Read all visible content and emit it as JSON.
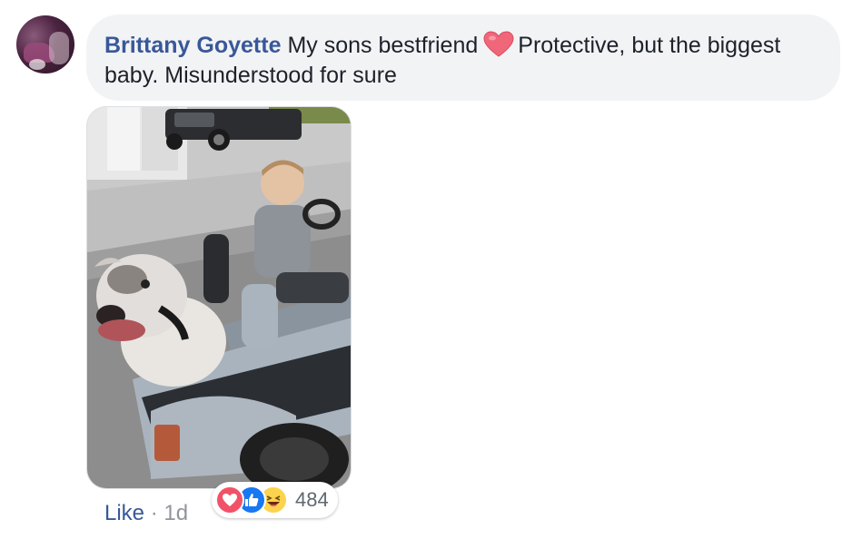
{
  "comment": {
    "author": "Brittany Goyette",
    "text_before_emoji": "My sons bestfriend",
    "emoji": "heart-emoji",
    "text_after_emoji": "Protective, but the biggest baby. Misunderstood for sure"
  },
  "actions": {
    "like_label": "Like",
    "separator": "·",
    "timestamp": "1d"
  },
  "reactions": {
    "icons": [
      "love-icon",
      "like-icon",
      "haha-icon"
    ],
    "count": "484"
  },
  "colors": {
    "author_link": "#385898",
    "bubble_bg": "#f2f3f5",
    "muted_text": "#90949c",
    "love": "#f25268",
    "like": "#1877f2",
    "haha": "#fcd34d"
  }
}
